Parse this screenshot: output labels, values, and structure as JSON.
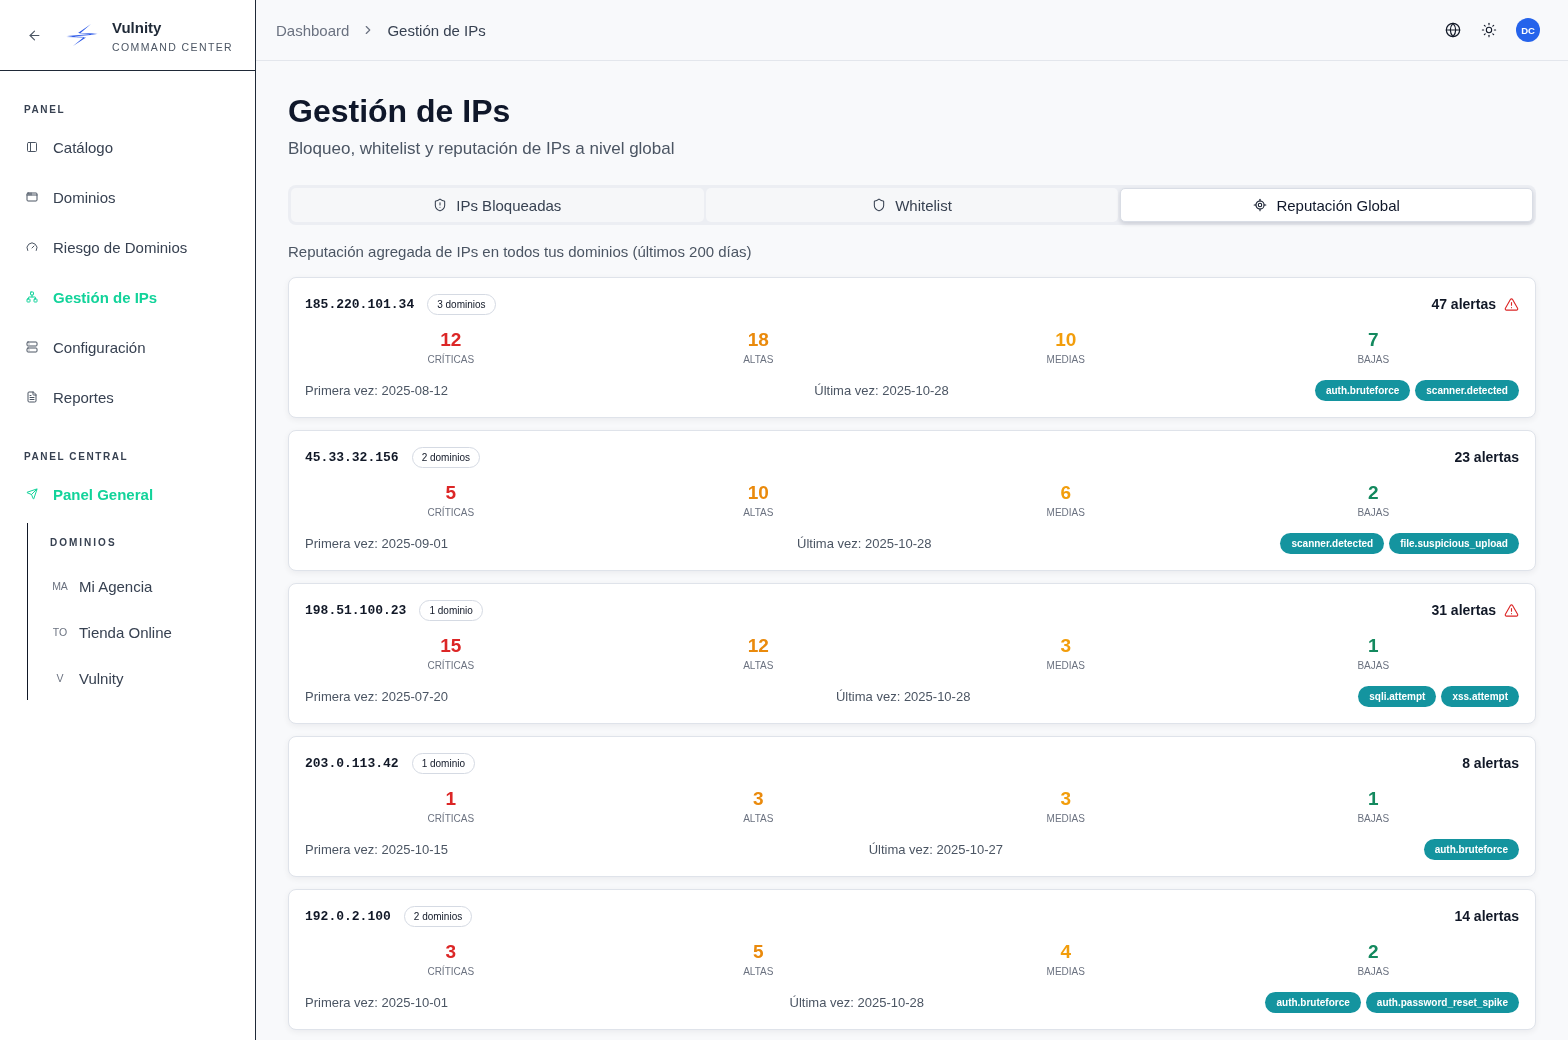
{
  "sidebar": {
    "brand": {
      "name": "Vulnity",
      "tagline": "COMMAND CENTER"
    },
    "sections": [
      {
        "title": "PANEL",
        "items": [
          {
            "label": "Catálogo",
            "selected": false
          },
          {
            "label": "Dominios",
            "selected": false
          },
          {
            "label": "Riesgo de Dominios",
            "selected": false
          },
          {
            "label": "Gestión de IPs",
            "selected": true
          },
          {
            "label": "Configuración",
            "selected": false
          },
          {
            "label": "Reportes",
            "selected": false
          }
        ]
      },
      {
        "title": "PANEL CENTRAL",
        "items": [
          {
            "label": "Panel General",
            "selected": true
          }
        ],
        "group": {
          "title": "DOMINIOS",
          "items": [
            {
              "initials": "MA",
              "label": "Mi Agencia"
            },
            {
              "initials": "TO",
              "label": "Tienda Online"
            },
            {
              "initials": "V",
              "label": "Vulnity"
            }
          ]
        }
      }
    ]
  },
  "breadcrumb": [
    "Dashboard",
    "Gestión de IPs"
  ],
  "user": {
    "initials": "DC"
  },
  "page": {
    "title": "Gestión de IPs",
    "subtitle": "Bloqueo, whitelist y reputación de IPs a nivel global"
  },
  "tabs": [
    {
      "label": "IPs Bloqueadas",
      "selected": false
    },
    {
      "label": "Whitelist",
      "selected": false
    },
    {
      "label": "Reputación Global",
      "selected": true
    }
  ],
  "description": "Reputación agregada de IPs en todos tus dominios (últimos 200 días)",
  "ip_cards": [
    {
      "ip": "185.220.101.34",
      "domains": "3 dominios",
      "alerts": "47 alertas",
      "warning": true,
      "stats": [
        {
          "kind": "critical",
          "value": "12",
          "label": "CRÍTICAS"
        },
        {
          "kind": "high",
          "value": "18",
          "label": "ALTAS"
        },
        {
          "kind": "medium",
          "value": "10",
          "label": "MEDIAS"
        },
        {
          "kind": "low",
          "value": "7",
          "label": "BAJAS"
        }
      ],
      "first_seen": "Primera vez: 2025-08-12",
      "last_seen": "Última vez: 2025-10-28",
      "tags": [
        "auth.bruteforce",
        "scanner.detected"
      ]
    },
    {
      "ip": "45.33.32.156",
      "domains": "2 dominios",
      "alerts": "23 alertas",
      "warning": false,
      "stats": [
        {
          "kind": "critical",
          "value": "5",
          "label": "CRÍTICAS"
        },
        {
          "kind": "high",
          "value": "10",
          "label": "ALTAS"
        },
        {
          "kind": "medium",
          "value": "6",
          "label": "MEDIAS"
        },
        {
          "kind": "low",
          "value": "2",
          "label": "BAJAS"
        }
      ],
      "first_seen": "Primera vez: 2025-09-01",
      "last_seen": "Última vez: 2025-10-28",
      "tags": [
        "scanner.detected",
        "file.suspicious_upload"
      ]
    },
    {
      "ip": "198.51.100.23",
      "domains": "1 dominio",
      "alerts": "31 alertas",
      "warning": true,
      "stats": [
        {
          "kind": "critical",
          "value": "15",
          "label": "CRÍTICAS"
        },
        {
          "kind": "high",
          "value": "12",
          "label": "ALTAS"
        },
        {
          "kind": "medium",
          "value": "3",
          "label": "MEDIAS"
        },
        {
          "kind": "low",
          "value": "1",
          "label": "BAJAS"
        }
      ],
      "first_seen": "Primera vez: 2025-07-20",
      "last_seen": "Última vez: 2025-10-28",
      "tags": [
        "sqli.attempt",
        "xss.attempt"
      ]
    },
    {
      "ip": "203.0.113.42",
      "domains": "1 dominio",
      "alerts": "8 alertas",
      "warning": false,
      "stats": [
        {
          "kind": "critical",
          "value": "1",
          "label": "CRÍTICAS"
        },
        {
          "kind": "high",
          "value": "3",
          "label": "ALTAS"
        },
        {
          "kind": "medium",
          "value": "3",
          "label": "MEDIAS"
        },
        {
          "kind": "low",
          "value": "1",
          "label": "BAJAS"
        }
      ],
      "first_seen": "Primera vez: 2025-10-15",
      "last_seen": "Última vez: 2025-10-27",
      "tags": [
        "auth.bruteforce"
      ]
    },
    {
      "ip": "192.0.2.100",
      "domains": "2 dominios",
      "alerts": "14 alertas",
      "warning": false,
      "stats": [
        {
          "kind": "critical",
          "value": "3",
          "label": "CRÍTICAS"
        },
        {
          "kind": "high",
          "value": "5",
          "label": "ALTAS"
        },
        {
          "kind": "medium",
          "value": "4",
          "label": "MEDIAS"
        },
        {
          "kind": "low",
          "value": "2",
          "label": "BAJAS"
        }
      ],
      "first_seen": "Primera vez: 2025-10-01",
      "last_seen": "Última vez: 2025-10-28",
      "tags": [
        "auth.bruteforce",
        "auth.password_reset_spike"
      ]
    }
  ]
}
